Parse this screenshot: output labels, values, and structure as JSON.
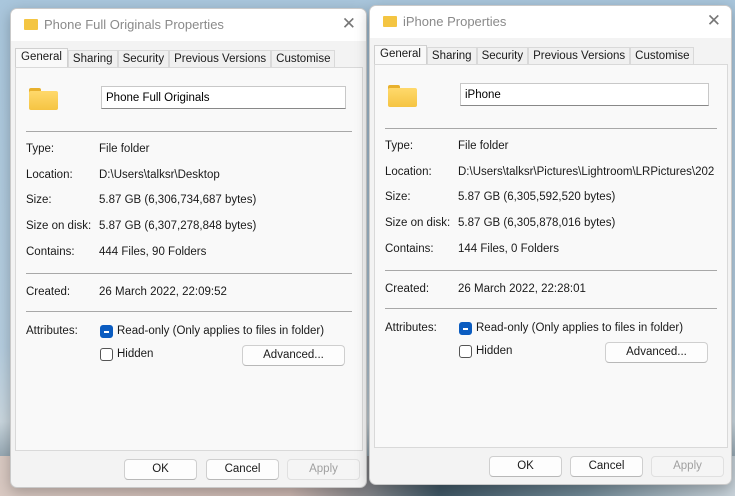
{
  "dialogs": [
    {
      "title": "Phone Full Originals Properties",
      "tabs": [
        "General",
        "Sharing",
        "Security",
        "Previous Versions",
        "Customise"
      ],
      "name": "Phone Full Originals",
      "rows": [
        {
          "label": "Type:",
          "value": "File folder"
        },
        {
          "label": "Location:",
          "value": "D:\\Users\\talksr\\Desktop"
        },
        {
          "label": "Size:",
          "value": "5.87 GB (6,306,734,687 bytes)"
        },
        {
          "label": "Size on disk:",
          "value": "5.87 GB (6,307,278,848 bytes)"
        },
        {
          "label": "Contains:",
          "value": "444 Files, 90 Folders"
        }
      ],
      "created_label": "Created:",
      "created": "26 March 2022, 22:09:52",
      "attributes_label": "Attributes:",
      "readonly": "Read-only (Only applies to files in folder)",
      "hidden": "Hidden",
      "advanced": "Advanced...",
      "ok": "OK",
      "cancel": "Cancel",
      "apply": "Apply"
    },
    {
      "title": "iPhone Properties",
      "tabs": [
        "General",
        "Sharing",
        "Security",
        "Previous Versions",
        "Customise"
      ],
      "name": "iPhone",
      "rows": [
        {
          "label": "Type:",
          "value": "File folder"
        },
        {
          "label": "Location:",
          "value": "D:\\Users\\talksr\\Pictures\\Lightroom\\LRPictures\\202"
        },
        {
          "label": "Size:",
          "value": "5.87 GB (6,305,592,520 bytes)"
        },
        {
          "label": "Size on disk:",
          "value": "5.87 GB (6,305,878,016 bytes)"
        },
        {
          "label": "Contains:",
          "value": "144 Files, 0 Folders"
        }
      ],
      "created_label": "Created:",
      "created": "26 March 2022, 22:28:01",
      "attributes_label": "Attributes:",
      "readonly": "Read-only (Only applies to files in folder)",
      "hidden": "Hidden",
      "advanced": "Advanced...",
      "ok": "OK",
      "cancel": "Cancel",
      "apply": "Apply"
    }
  ]
}
